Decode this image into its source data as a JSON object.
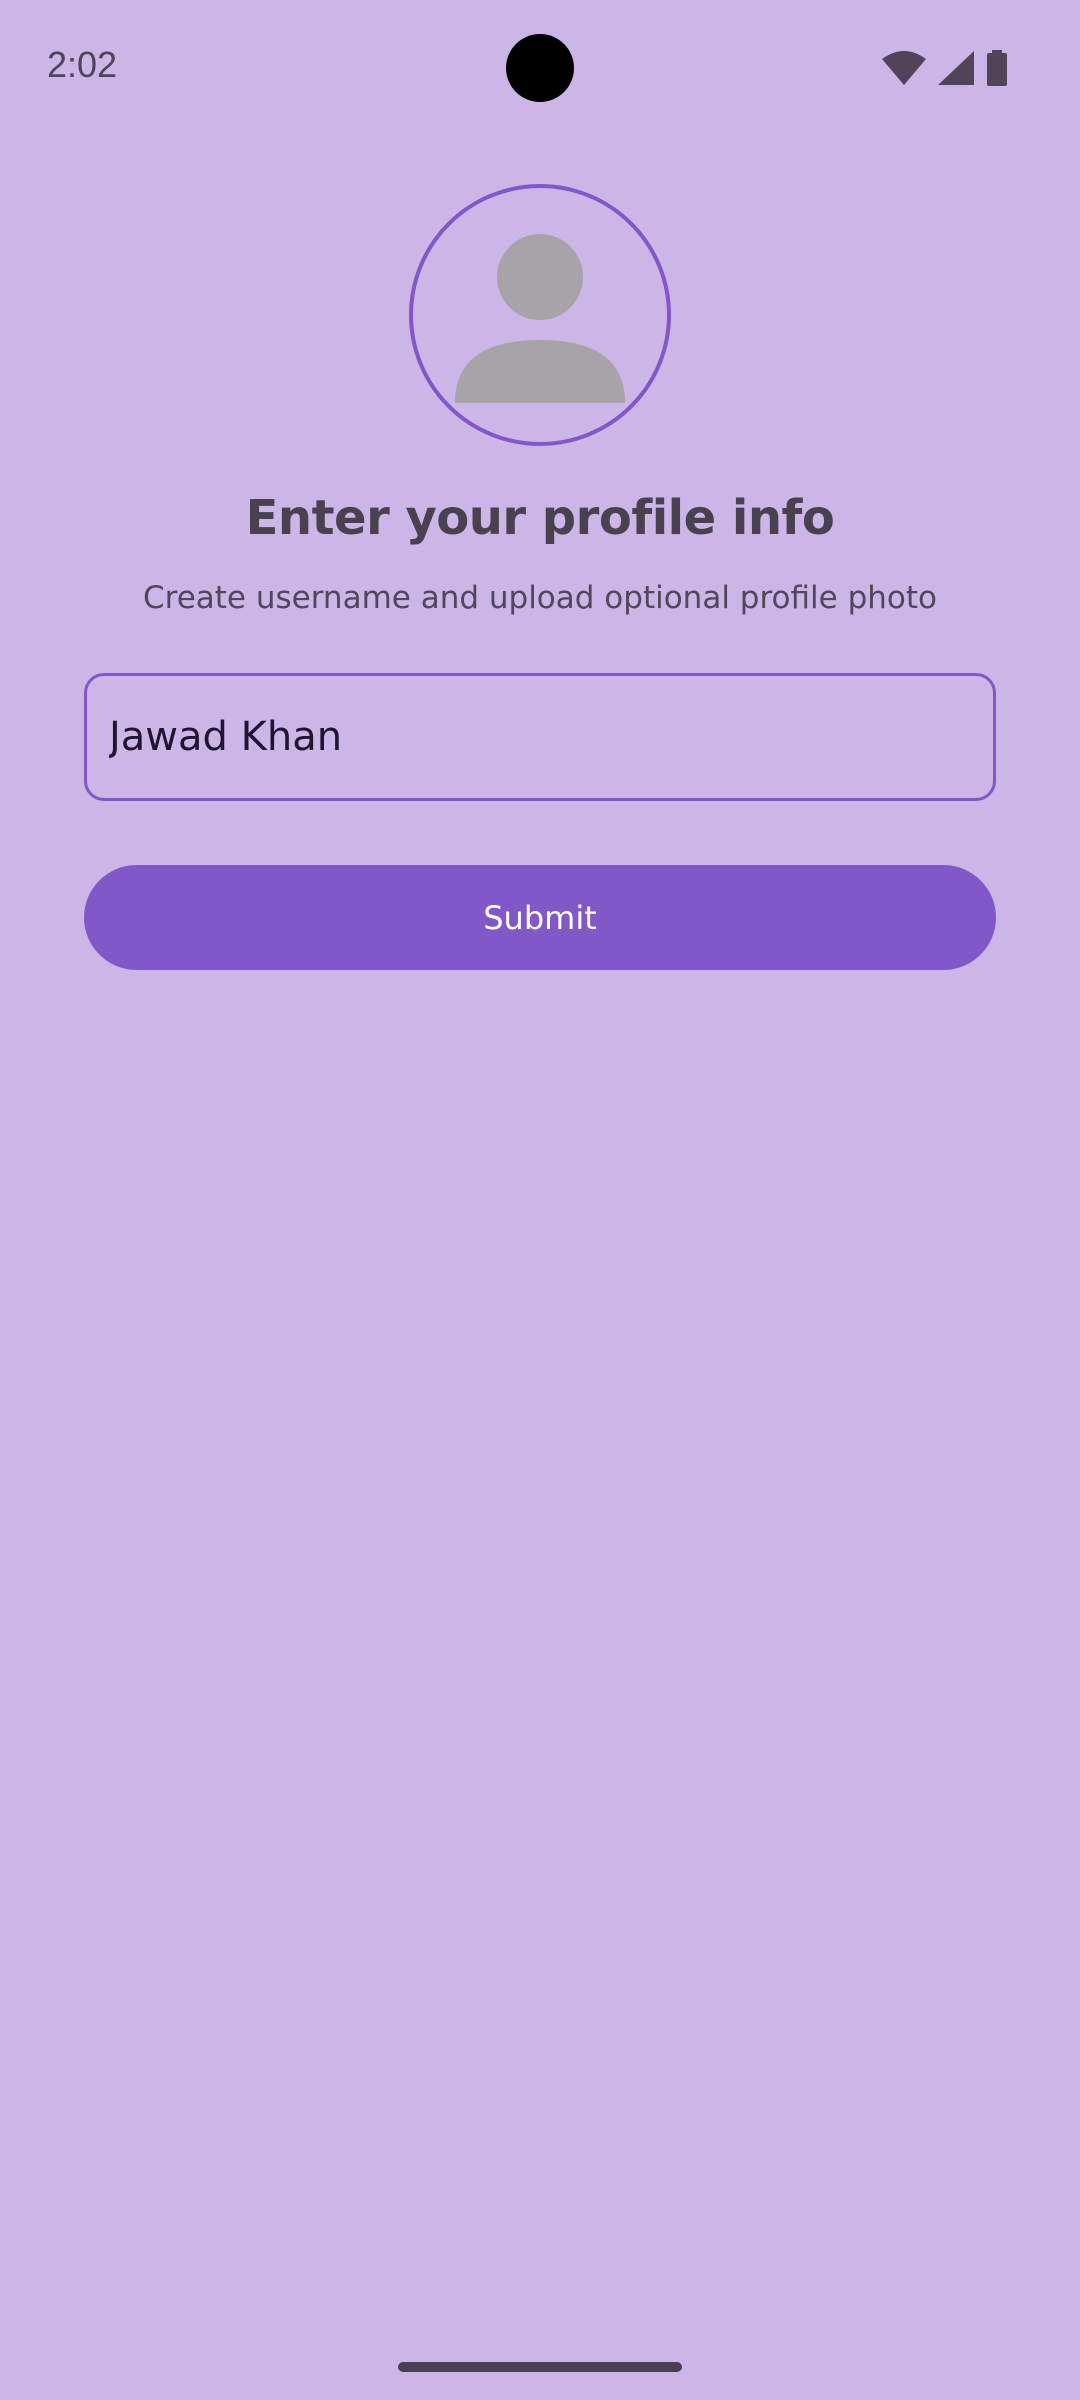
{
  "status_bar": {
    "time": "2:02",
    "icons": [
      "wifi-icon",
      "cellular-signal-icon",
      "battery-icon"
    ]
  },
  "profile": {
    "avatar_icon": "person-placeholder-icon",
    "title": "Enter your profile info",
    "subtitle": "Create username and upload optional profile photo"
  },
  "form": {
    "username_value": "Jawad Khan",
    "submit_label": "Submit"
  },
  "colors": {
    "background": "#ccb5e7",
    "accent": "#8258c9",
    "title_text": "#4a4150",
    "placeholder_gray": "#a7a3a9"
  }
}
